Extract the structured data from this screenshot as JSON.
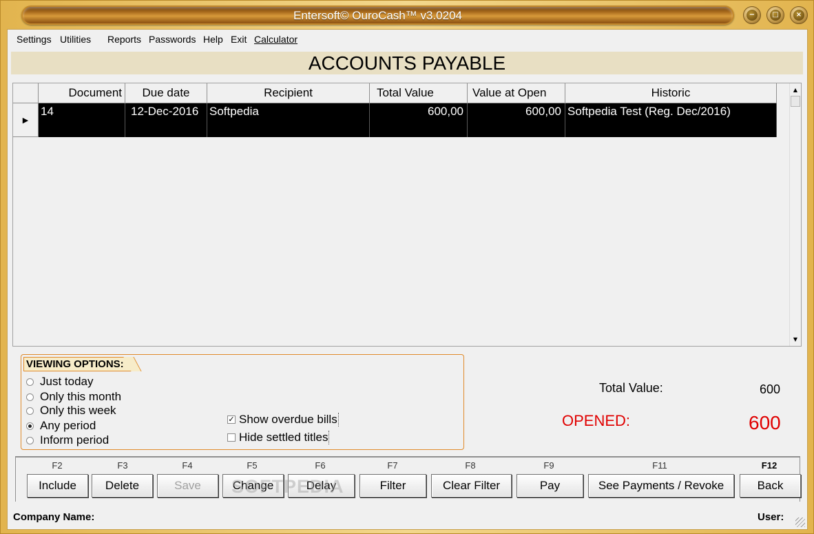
{
  "window": {
    "title": "Entersoft© OuroCash™ v3.0204"
  },
  "menu": [
    "Settings",
    "Utilities",
    "Reports",
    "Passwords",
    "Help",
    "Exit",
    "Calculator"
  ],
  "page_title": "ACCOUNTS PAYABLE",
  "grid": {
    "columns": [
      "Document",
      "Due date",
      "Recipient",
      "Total Value",
      "Value at Open",
      "Historic"
    ],
    "rows": [
      {
        "document": "14",
        "due_date": "12-Dec-2016",
        "recipient": "Softpedia",
        "total_value": "600,00",
        "value_at_open": "600,00",
        "historic": "Softpedia Test (Reg. Dec/2016)"
      }
    ]
  },
  "viewing_options": {
    "title": "VIEWING OPTIONS:",
    "periods": [
      "Just today",
      "Only this month",
      "Only this week",
      "Any period",
      "Inform period"
    ],
    "selected_period": "Any period",
    "show_overdue_label": "Show overdue bills",
    "show_overdue_checked": true,
    "hide_settled_label": "Hide settled titles",
    "hide_settled_checked": false
  },
  "totals": {
    "total_label": "Total Value:",
    "total_value": "600",
    "opened_label": "OPENED:",
    "opened_value": "600",
    "opened_color": "#e00000"
  },
  "function_keys": [
    {
      "key": "F2",
      "label": "Include",
      "enabled": true
    },
    {
      "key": "F3",
      "label": "Delete",
      "enabled": true
    },
    {
      "key": "F4",
      "label": "Save",
      "enabled": false
    },
    {
      "key": "F5",
      "label": "Change",
      "enabled": true
    },
    {
      "key": "F6",
      "label": "Delay",
      "enabled": true
    },
    {
      "key": "F7",
      "label": "Filter",
      "enabled": true
    },
    {
      "key": "F8",
      "label": "Clear Filter",
      "enabled": true
    },
    {
      "key": "F9",
      "label": "Pay",
      "enabled": true
    },
    {
      "key": "F11",
      "label": "See Payments / Revoke",
      "enabled": true
    },
    {
      "key": "F12",
      "label": "Back",
      "enabled": true
    }
  ],
  "watermark": "SOFTPEDIA",
  "status": {
    "company_label": "Company Name:",
    "user_label": "User:"
  },
  "icons": {
    "minimize": "minimize-icon",
    "restore": "restore-icon",
    "close": "close-icon",
    "row_pointer": "row-pointer-icon"
  }
}
